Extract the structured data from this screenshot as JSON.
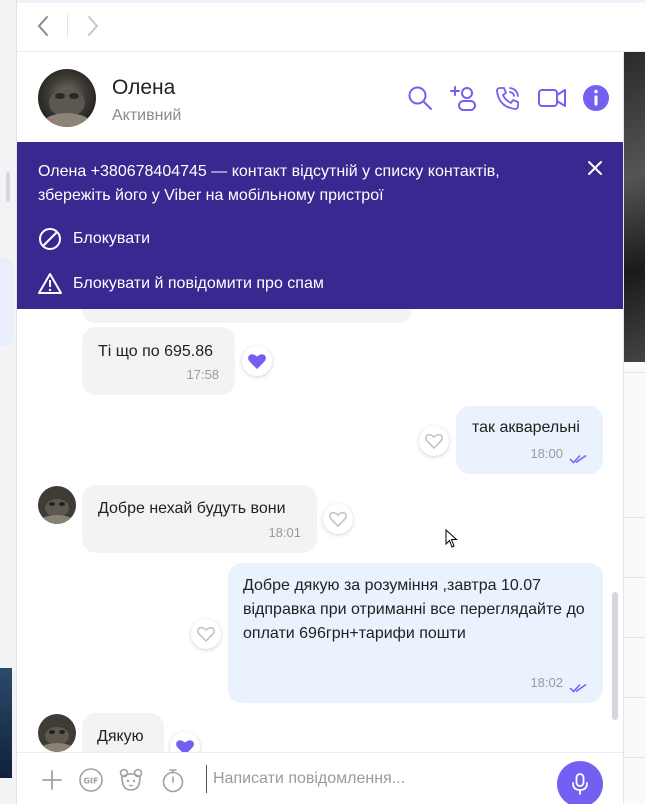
{
  "header": {
    "contact_name": "Олена",
    "contact_status": "Активний"
  },
  "banner": {
    "text": "Олена +380678404745 — контакт відсутній у списку контактів, збережіть його у Viber на мобільному пристрої",
    "block_label": "Блокувати",
    "block_spam_label": "Блокувати й повідомити про спам",
    "background": "#3b2790"
  },
  "messages": [
    {
      "direction": "in",
      "text": "Ті що по 695.86",
      "time": "17:58",
      "liked": true
    },
    {
      "direction": "out",
      "text": "так акварельні",
      "time": "18:00",
      "liked": false
    },
    {
      "direction": "in",
      "text": "Добре нехай будуть вони",
      "time": "18:01",
      "liked": false
    },
    {
      "direction": "out",
      "text": "Добре дякую за розуміння ,завтра 10.07 відправка при отриманні все переглядайте до оплати 696грн+тарифи пошти",
      "time": "18:02",
      "liked": false
    },
    {
      "direction": "in",
      "text": "Дякую",
      "time": "",
      "liked": true
    }
  ],
  "composer": {
    "placeholder": "Написати повідомлення..."
  },
  "colors": {
    "accent": "#7360f2",
    "incoming_bubble": "#f3f3f3",
    "outgoing_bubble": "#e9f2fd"
  },
  "icons": [
    "back-icon",
    "forward-icon",
    "search-icon",
    "add-participant-icon",
    "call-icon",
    "video-call-icon",
    "info-icon",
    "close-icon",
    "block-icon",
    "warning-icon",
    "heart-icon",
    "double-check-icon",
    "plus-icon",
    "gif-icon",
    "sticker-icon",
    "timer-icon",
    "microphone-icon"
  ]
}
